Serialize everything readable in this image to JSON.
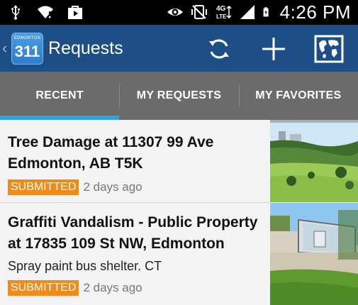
{
  "status_bar": {
    "time": "4:26 PM",
    "icons": [
      "usb-icon",
      "wifi-icon",
      "play-store-icon",
      "eye-icon",
      "vibrate-icon",
      "lte-icon",
      "signal-icon",
      "battery-charging-icon"
    ],
    "network_label": "4G LTE"
  },
  "action_bar": {
    "logo_top_text": "EDMONTON",
    "logo_number": "311",
    "title": "Requests",
    "icons": [
      "refresh-icon",
      "add-icon",
      "map-icon"
    ],
    "background": "#1d4f86"
  },
  "tabs": [
    {
      "label": "RECENT",
      "active": true
    },
    {
      "label": "MY REQUESTS",
      "active": false
    },
    {
      "label": "MY FAVORITES",
      "active": false
    }
  ],
  "accent_color": "#33a3dc",
  "requests": [
    {
      "title": "Tree Damage at 11307 99 Ave Edmonton, AB T5K",
      "description": "",
      "status": "SUBMITTED",
      "age": "2 days ago",
      "thumbnail": "park-photo"
    },
    {
      "title": "Graffiti Vandalism - Public Property at 17835 109 St NW, Edmonton",
      "description": "Spray paint bus shelter. CT",
      "status": "SUBMITTED",
      "age": "2 days ago",
      "thumbnail": "bus-shelter-photo"
    }
  ],
  "status_color": "#f28a1b"
}
